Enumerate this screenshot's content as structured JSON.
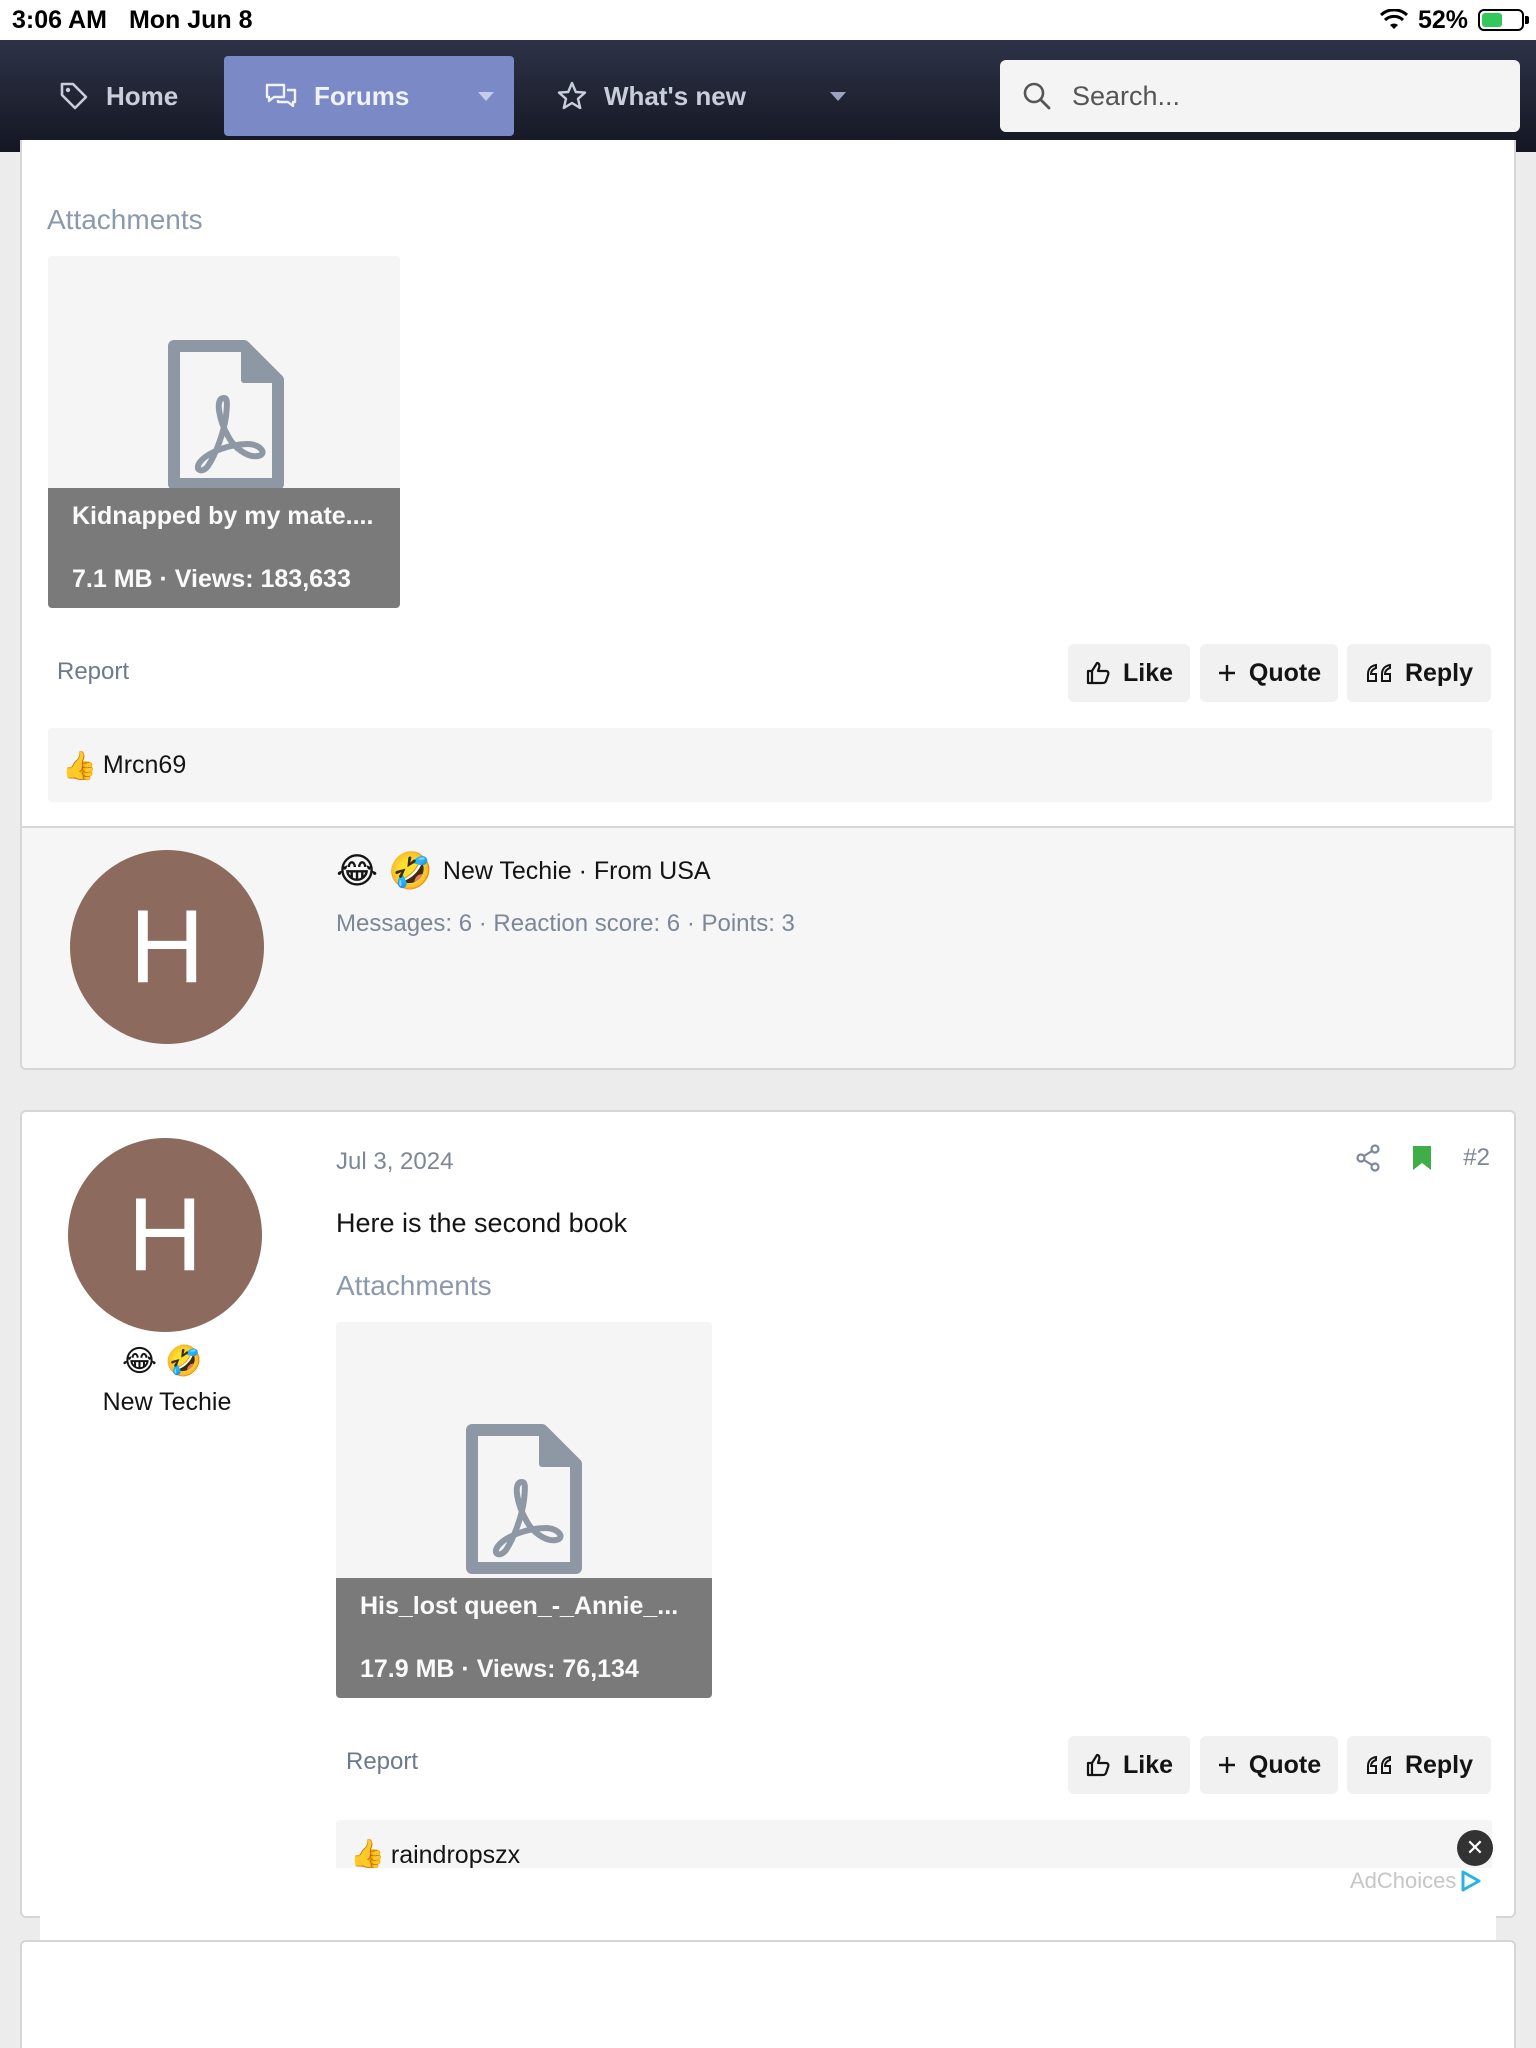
{
  "status_bar": {
    "time": "3:06 AM",
    "date": "Mon Jun 8",
    "battery": "52%",
    "battery_level": 0.52
  },
  "nav": {
    "home": "Home",
    "forums": "Forums",
    "whats_new": "What's new",
    "search_placeholder": "Search..."
  },
  "post1": {
    "attachments_heading": "Attachments",
    "attachment": {
      "name": "Kidnapped by my mate....",
      "meta": "7.1 MB · Views: 183,633"
    },
    "report": "Report",
    "actions": {
      "like": "Like",
      "quote": "Quote",
      "reply": "Reply"
    },
    "reaction_user": "Mrcn69",
    "member": {
      "avatar_letter": "H",
      "badges": "😂 🤣",
      "title_line": "New Techie · From USA",
      "stats": "Messages: 6 · Reaction score: 6 · Points: 3"
    }
  },
  "post2": {
    "avatar_letter": "H",
    "badges": "😂 🤣",
    "user_title": "New Techie",
    "date": "Jul 3, 2024",
    "post_number": "#2",
    "body": "Here is the second book",
    "attachments_heading": "Attachments",
    "attachment": {
      "name": "His_lost queen_-_Annie_...",
      "meta": "17.9 MB · Views: 76,134"
    },
    "report": "Report",
    "actions": {
      "like": "Like",
      "quote": "Quote",
      "reply": "Reply"
    },
    "reaction_user": "raindropszx"
  },
  "ad": {
    "close": "✕",
    "label": "AdChoices"
  },
  "colors": {
    "accent": "#7b89c6",
    "avatar": "#8c6a5e",
    "bookmark": "#3fae49",
    "caption": "#7a7a7a"
  }
}
